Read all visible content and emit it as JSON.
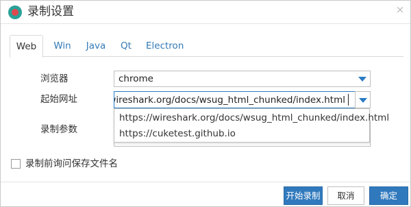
{
  "dialog": {
    "title": "录制设置",
    "close_glyph": "×"
  },
  "tabs": [
    {
      "label": "Web",
      "active": true
    },
    {
      "label": "Win",
      "active": false
    },
    {
      "label": "Java",
      "active": false
    },
    {
      "label": "Qt",
      "active": false
    },
    {
      "label": "Electron",
      "active": false
    }
  ],
  "form": {
    "browser_label": "浏览器",
    "browser_value": "chrome",
    "url_label": "起始网址",
    "url_value": "os://wireshark.org/docs/wsug_html_chunked/index.html",
    "url_options": [
      "https://wireshark.org/docs/wsug_html_chunked/index.html",
      "https://cuketest.github.io"
    ],
    "params_label": "录制参数",
    "ask_save_label": "录制前询问保存文件名",
    "ask_save_checked": false
  },
  "buttons": {
    "start": "开始录制",
    "cancel": "取消",
    "ok": "确定"
  },
  "colors": {
    "accent": "#3079bd",
    "tab_link": "#337ab7",
    "icon_outer": "#2aa198",
    "icon_inner": "#e0484e"
  }
}
